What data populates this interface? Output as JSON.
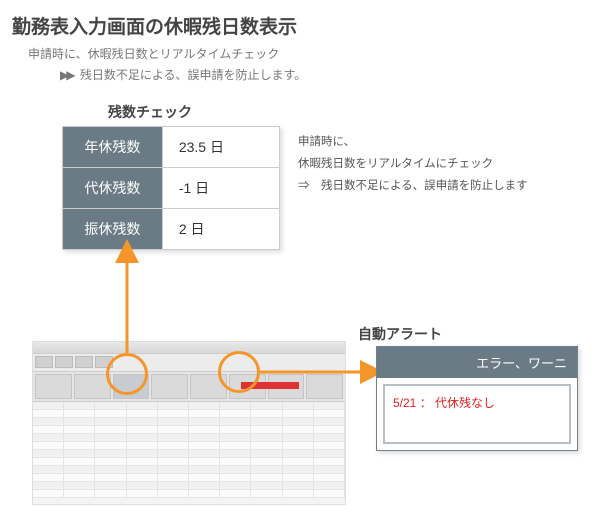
{
  "title": "勤務表入力画面の休暇残日数表示",
  "subtitle1": "申請時に、休暇残日数とリアルタイムチェック",
  "subtitle2_arrow": "▶▶",
  "subtitle2": "残日数不足による、誤申請を防止します。",
  "remain_section_label": "残数チェック",
  "alert_section_label": "自動アラート",
  "balance": {
    "rows": [
      {
        "label": "年休残数",
        "value": "23.5 日"
      },
      {
        "label": "代休残数",
        "value": "-1 日"
      },
      {
        "label": "振休残数",
        "value": "2 日"
      }
    ]
  },
  "desc_line1": "申請時に、",
  "desc_line2": "休暇残日数をリアルタイムにチェック",
  "desc_line3": "⇒　残日数不足による、誤申請を防止します",
  "alert": {
    "header": "エラー、ワーニ",
    "message": "5/21 ： 代休残なし"
  },
  "colors": {
    "header_bg": "#6b7b86",
    "orange": "#f4962a",
    "error_red": "#d22"
  }
}
